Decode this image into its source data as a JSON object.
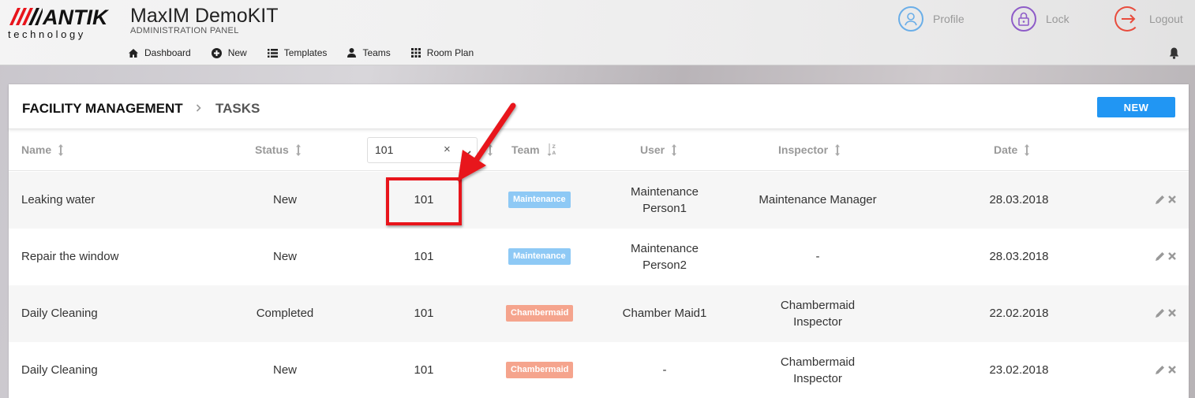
{
  "brand": {
    "logo_text": "ANTIK",
    "logo_sub": "technology",
    "title": "MaxIM DemoKIT",
    "subtitle": "ADMINISTRATION PANEL"
  },
  "top_actions": [
    {
      "label": "Profile",
      "icon": "user-icon",
      "color": "#6aaee8"
    },
    {
      "label": "Lock",
      "icon": "lock-icon",
      "color": "#8e5cc8"
    },
    {
      "label": "Logout",
      "icon": "logout-icon",
      "color": "#e84c3d"
    }
  ],
  "nav": [
    {
      "label": "Dashboard",
      "icon": "home-icon"
    },
    {
      "label": "New",
      "icon": "plus-circle-icon"
    },
    {
      "label": "Templates",
      "icon": "list-icon"
    },
    {
      "label": "Teams",
      "icon": "user-icon"
    },
    {
      "label": "Room Plan",
      "icon": "grid-icon"
    }
  ],
  "breadcrumb": {
    "section": "FACILITY MANAGEMENT",
    "separator": ">",
    "page": "TASKS"
  },
  "new_button": "NEW",
  "columns": {
    "name": "Name",
    "status": "Status",
    "team": "Team",
    "user": "User",
    "inspector": "Inspector",
    "date": "Date"
  },
  "room_filter": {
    "value": "101",
    "clear": "×"
  },
  "rows": [
    {
      "name": "Leaking water",
      "status": "New",
      "room": "101",
      "team": "Maintenance",
      "team_color": "#8ec9f5",
      "user_line1": "Maintenance",
      "user_line2": "Person1",
      "inspector_line1": "Maintenance Manager",
      "inspector_line2": "",
      "date": "28.03.2018"
    },
    {
      "name": "Repair the window",
      "status": "New",
      "room": "101",
      "team": "Maintenance",
      "team_color": "#8ec9f5",
      "user_line1": "Maintenance",
      "user_line2": "Person2",
      "inspector_line1": "-",
      "inspector_line2": "",
      "date": "28.03.2018"
    },
    {
      "name": "Daily Cleaning",
      "status": "Completed",
      "room": "101",
      "team": "Chambermaid",
      "team_color": "#f5a48d",
      "user_line1": "Chamber Maid1",
      "user_line2": "",
      "inspector_line1": "Chambermaid",
      "inspector_line2": "Inspector",
      "date": "22.02.2018"
    },
    {
      "name": "Daily Cleaning",
      "status": "New",
      "room": "101",
      "team": "Chambermaid",
      "team_color": "#f5a48d",
      "user_line1": "-",
      "user_line2": "",
      "inspector_line1": "Chambermaid",
      "inspector_line2": "Inspector",
      "date": "23.02.2018"
    }
  ],
  "colors": {
    "accent": "#2196f3",
    "annotation": "#e8141b"
  }
}
